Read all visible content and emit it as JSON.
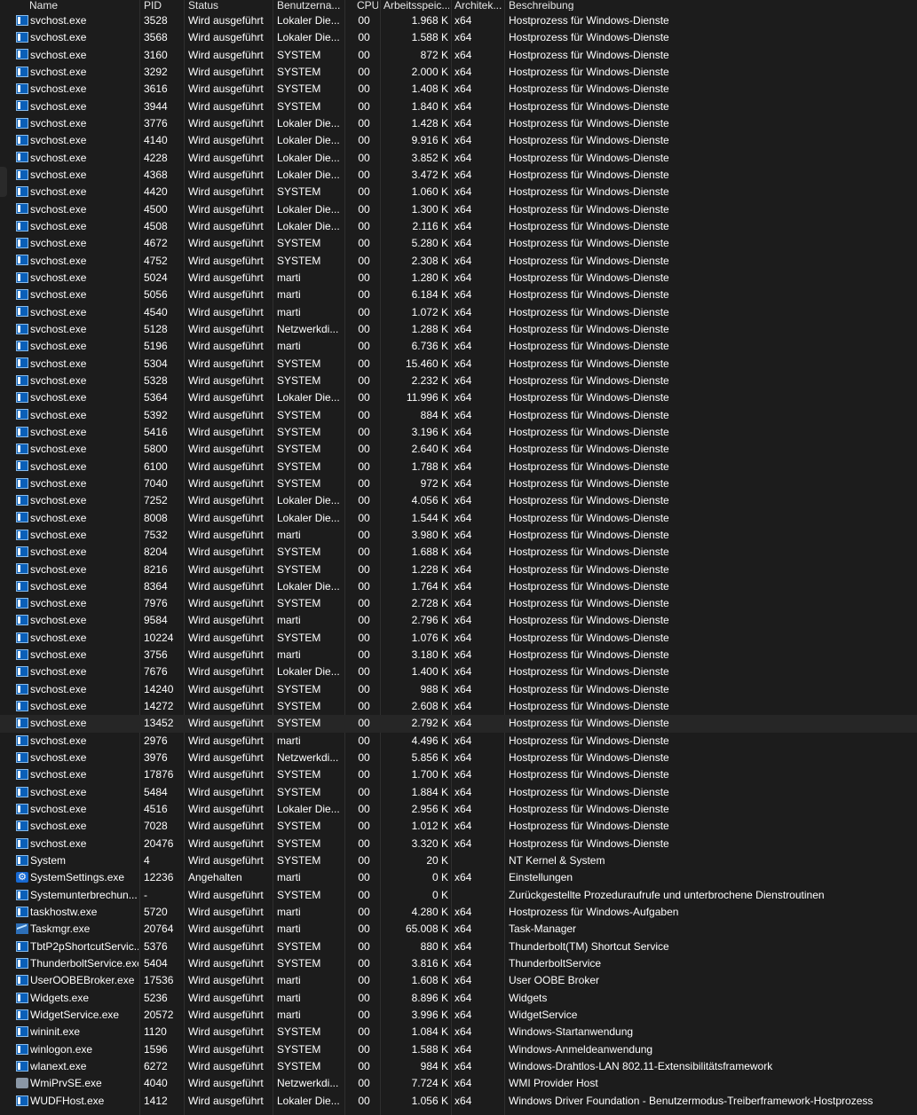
{
  "header": {
    "name": "Name",
    "pid": "PID",
    "status": "Status",
    "user": "Benutzerna...",
    "cpu": "CPU",
    "mem": "Arbeitsspeic...",
    "arch": "Architek...",
    "desc": "Beschreibung"
  },
  "rows": [
    {
      "icon": "window-icon",
      "name": "svchost.exe",
      "pid": "3528",
      "status": "Wird ausgeführt",
      "user": "Lokaler Die...",
      "cpu": "00",
      "mem": "1.968 K",
      "arch": "x64",
      "desc": "Hostprozess für Windows-Dienste"
    },
    {
      "icon": "window-icon",
      "name": "svchost.exe",
      "pid": "3568",
      "status": "Wird ausgeführt",
      "user": "Lokaler Die...",
      "cpu": "00",
      "mem": "1.588 K",
      "arch": "x64",
      "desc": "Hostprozess für Windows-Dienste"
    },
    {
      "icon": "window-icon",
      "name": "svchost.exe",
      "pid": "3160",
      "status": "Wird ausgeführt",
      "user": "SYSTEM",
      "cpu": "00",
      "mem": "872 K",
      "arch": "x64",
      "desc": "Hostprozess für Windows-Dienste"
    },
    {
      "icon": "window-icon",
      "name": "svchost.exe",
      "pid": "3292",
      "status": "Wird ausgeführt",
      "user": "SYSTEM",
      "cpu": "00",
      "mem": "2.000 K",
      "arch": "x64",
      "desc": "Hostprozess für Windows-Dienste"
    },
    {
      "icon": "window-icon",
      "name": "svchost.exe",
      "pid": "3616",
      "status": "Wird ausgeführt",
      "user": "SYSTEM",
      "cpu": "00",
      "mem": "1.408 K",
      "arch": "x64",
      "desc": "Hostprozess für Windows-Dienste"
    },
    {
      "icon": "window-icon",
      "name": "svchost.exe",
      "pid": "3944",
      "status": "Wird ausgeführt",
      "user": "SYSTEM",
      "cpu": "00",
      "mem": "1.840 K",
      "arch": "x64",
      "desc": "Hostprozess für Windows-Dienste"
    },
    {
      "icon": "window-icon",
      "name": "svchost.exe",
      "pid": "3776",
      "status": "Wird ausgeführt",
      "user": "Lokaler Die...",
      "cpu": "00",
      "mem": "1.428 K",
      "arch": "x64",
      "desc": "Hostprozess für Windows-Dienste"
    },
    {
      "icon": "window-icon",
      "name": "svchost.exe",
      "pid": "4140",
      "status": "Wird ausgeführt",
      "user": "Lokaler Die...",
      "cpu": "00",
      "mem": "9.916 K",
      "arch": "x64",
      "desc": "Hostprozess für Windows-Dienste"
    },
    {
      "icon": "window-icon",
      "name": "svchost.exe",
      "pid": "4228",
      "status": "Wird ausgeführt",
      "user": "Lokaler Die...",
      "cpu": "00",
      "mem": "3.852 K",
      "arch": "x64",
      "desc": "Hostprozess für Windows-Dienste"
    },
    {
      "icon": "window-icon",
      "name": "svchost.exe",
      "pid": "4368",
      "status": "Wird ausgeführt",
      "user": "Lokaler Die...",
      "cpu": "00",
      "mem": "3.472 K",
      "arch": "x64",
      "desc": "Hostprozess für Windows-Dienste"
    },
    {
      "icon": "window-icon",
      "name": "svchost.exe",
      "pid": "4420",
      "status": "Wird ausgeführt",
      "user": "SYSTEM",
      "cpu": "00",
      "mem": "1.060 K",
      "arch": "x64",
      "desc": "Hostprozess für Windows-Dienste"
    },
    {
      "icon": "window-icon",
      "name": "svchost.exe",
      "pid": "4500",
      "status": "Wird ausgeführt",
      "user": "Lokaler Die...",
      "cpu": "00",
      "mem": "1.300 K",
      "arch": "x64",
      "desc": "Hostprozess für Windows-Dienste"
    },
    {
      "icon": "window-icon",
      "name": "svchost.exe",
      "pid": "4508",
      "status": "Wird ausgeführt",
      "user": "Lokaler Die...",
      "cpu": "00",
      "mem": "2.116 K",
      "arch": "x64",
      "desc": "Hostprozess für Windows-Dienste"
    },
    {
      "icon": "window-icon",
      "name": "svchost.exe",
      "pid": "4672",
      "status": "Wird ausgeführt",
      "user": "SYSTEM",
      "cpu": "00",
      "mem": "5.280 K",
      "arch": "x64",
      "desc": "Hostprozess für Windows-Dienste"
    },
    {
      "icon": "window-icon",
      "name": "svchost.exe",
      "pid": "4752",
      "status": "Wird ausgeführt",
      "user": "SYSTEM",
      "cpu": "00",
      "mem": "2.308 K",
      "arch": "x64",
      "desc": "Hostprozess für Windows-Dienste"
    },
    {
      "icon": "window-icon",
      "name": "svchost.exe",
      "pid": "5024",
      "status": "Wird ausgeführt",
      "user": "marti",
      "cpu": "00",
      "mem": "1.280 K",
      "arch": "x64",
      "desc": "Hostprozess für Windows-Dienste"
    },
    {
      "icon": "window-icon",
      "name": "svchost.exe",
      "pid": "5056",
      "status": "Wird ausgeführt",
      "user": "marti",
      "cpu": "00",
      "mem": "6.184 K",
      "arch": "x64",
      "desc": "Hostprozess für Windows-Dienste"
    },
    {
      "icon": "window-icon",
      "name": "svchost.exe",
      "pid": "4540",
      "status": "Wird ausgeführt",
      "user": "marti",
      "cpu": "00",
      "mem": "1.072 K",
      "arch": "x64",
      "desc": "Hostprozess für Windows-Dienste"
    },
    {
      "icon": "window-icon",
      "name": "svchost.exe",
      "pid": "5128",
      "status": "Wird ausgeführt",
      "user": "Netzwerkdi...",
      "cpu": "00",
      "mem": "1.288 K",
      "arch": "x64",
      "desc": "Hostprozess für Windows-Dienste"
    },
    {
      "icon": "window-icon",
      "name": "svchost.exe",
      "pid": "5196",
      "status": "Wird ausgeführt",
      "user": "marti",
      "cpu": "00",
      "mem": "6.736 K",
      "arch": "x64",
      "desc": "Hostprozess für Windows-Dienste"
    },
    {
      "icon": "window-icon",
      "name": "svchost.exe",
      "pid": "5304",
      "status": "Wird ausgeführt",
      "user": "SYSTEM",
      "cpu": "00",
      "mem": "15.460 K",
      "arch": "x64",
      "desc": "Hostprozess für Windows-Dienste"
    },
    {
      "icon": "window-icon",
      "name": "svchost.exe",
      "pid": "5328",
      "status": "Wird ausgeführt",
      "user": "SYSTEM",
      "cpu": "00",
      "mem": "2.232 K",
      "arch": "x64",
      "desc": "Hostprozess für Windows-Dienste"
    },
    {
      "icon": "window-icon",
      "name": "svchost.exe",
      "pid": "5364",
      "status": "Wird ausgeführt",
      "user": "Lokaler Die...",
      "cpu": "00",
      "mem": "11.996 K",
      "arch": "x64",
      "desc": "Hostprozess für Windows-Dienste"
    },
    {
      "icon": "window-icon",
      "name": "svchost.exe",
      "pid": "5392",
      "status": "Wird ausgeführt",
      "user": "SYSTEM",
      "cpu": "00",
      "mem": "884 K",
      "arch": "x64",
      "desc": "Hostprozess für Windows-Dienste"
    },
    {
      "icon": "window-icon",
      "name": "svchost.exe",
      "pid": "5416",
      "status": "Wird ausgeführt",
      "user": "SYSTEM",
      "cpu": "00",
      "mem": "3.196 K",
      "arch": "x64",
      "desc": "Hostprozess für Windows-Dienste"
    },
    {
      "icon": "window-icon",
      "name": "svchost.exe",
      "pid": "5800",
      "status": "Wird ausgeführt",
      "user": "SYSTEM",
      "cpu": "00",
      "mem": "2.640 K",
      "arch": "x64",
      "desc": "Hostprozess für Windows-Dienste"
    },
    {
      "icon": "window-icon",
      "name": "svchost.exe",
      "pid": "6100",
      "status": "Wird ausgeführt",
      "user": "SYSTEM",
      "cpu": "00",
      "mem": "1.788 K",
      "arch": "x64",
      "desc": "Hostprozess für Windows-Dienste"
    },
    {
      "icon": "window-icon",
      "name": "svchost.exe",
      "pid": "7040",
      "status": "Wird ausgeführt",
      "user": "SYSTEM",
      "cpu": "00",
      "mem": "972 K",
      "arch": "x64",
      "desc": "Hostprozess für Windows-Dienste"
    },
    {
      "icon": "window-icon",
      "name": "svchost.exe",
      "pid": "7252",
      "status": "Wird ausgeführt",
      "user": "Lokaler Die...",
      "cpu": "00",
      "mem": "4.056 K",
      "arch": "x64",
      "desc": "Hostprozess für Windows-Dienste"
    },
    {
      "icon": "window-icon",
      "name": "svchost.exe",
      "pid": "8008",
      "status": "Wird ausgeführt",
      "user": "Lokaler Die...",
      "cpu": "00",
      "mem": "1.544 K",
      "arch": "x64",
      "desc": "Hostprozess für Windows-Dienste"
    },
    {
      "icon": "window-icon",
      "name": "svchost.exe",
      "pid": "7532",
      "status": "Wird ausgeführt",
      "user": "marti",
      "cpu": "00",
      "mem": "3.980 K",
      "arch": "x64",
      "desc": "Hostprozess für Windows-Dienste"
    },
    {
      "icon": "window-icon",
      "name": "svchost.exe",
      "pid": "8204",
      "status": "Wird ausgeführt",
      "user": "SYSTEM",
      "cpu": "00",
      "mem": "1.688 K",
      "arch": "x64",
      "desc": "Hostprozess für Windows-Dienste"
    },
    {
      "icon": "window-icon",
      "name": "svchost.exe",
      "pid": "8216",
      "status": "Wird ausgeführt",
      "user": "SYSTEM",
      "cpu": "00",
      "mem": "1.228 K",
      "arch": "x64",
      "desc": "Hostprozess für Windows-Dienste"
    },
    {
      "icon": "window-icon",
      "name": "svchost.exe",
      "pid": "8364",
      "status": "Wird ausgeführt",
      "user": "Lokaler Die...",
      "cpu": "00",
      "mem": "1.764 K",
      "arch": "x64",
      "desc": "Hostprozess für Windows-Dienste"
    },
    {
      "icon": "window-icon",
      "name": "svchost.exe",
      "pid": "7976",
      "status": "Wird ausgeführt",
      "user": "SYSTEM",
      "cpu": "00",
      "mem": "2.728 K",
      "arch": "x64",
      "desc": "Hostprozess für Windows-Dienste"
    },
    {
      "icon": "window-icon",
      "name": "svchost.exe",
      "pid": "9584",
      "status": "Wird ausgeführt",
      "user": "marti",
      "cpu": "00",
      "mem": "2.796 K",
      "arch": "x64",
      "desc": "Hostprozess für Windows-Dienste"
    },
    {
      "icon": "window-icon",
      "name": "svchost.exe",
      "pid": "10224",
      "status": "Wird ausgeführt",
      "user": "SYSTEM",
      "cpu": "00",
      "mem": "1.076 K",
      "arch": "x64",
      "desc": "Hostprozess für Windows-Dienste"
    },
    {
      "icon": "window-icon",
      "name": "svchost.exe",
      "pid": "3756",
      "status": "Wird ausgeführt",
      "user": "marti",
      "cpu": "00",
      "mem": "3.180 K",
      "arch": "x64",
      "desc": "Hostprozess für Windows-Dienste"
    },
    {
      "icon": "window-icon",
      "name": "svchost.exe",
      "pid": "7676",
      "status": "Wird ausgeführt",
      "user": "Lokaler Die...",
      "cpu": "00",
      "mem": "1.400 K",
      "arch": "x64",
      "desc": "Hostprozess für Windows-Dienste"
    },
    {
      "icon": "window-icon",
      "name": "svchost.exe",
      "pid": "14240",
      "status": "Wird ausgeführt",
      "user": "SYSTEM",
      "cpu": "00",
      "mem": "988 K",
      "arch": "x64",
      "desc": "Hostprozess für Windows-Dienste"
    },
    {
      "icon": "window-icon",
      "name": "svchost.exe",
      "pid": "14272",
      "status": "Wird ausgeführt",
      "user": "SYSTEM",
      "cpu": "00",
      "mem": "2.608 K",
      "arch": "x64",
      "desc": "Hostprozess für Windows-Dienste"
    },
    {
      "icon": "window-icon",
      "name": "svchost.exe",
      "pid": "13452",
      "status": "Wird ausgeführt",
      "user": "SYSTEM",
      "cpu": "00",
      "mem": "2.792 K",
      "arch": "x64",
      "desc": "Hostprozess für Windows-Dienste",
      "selected": true
    },
    {
      "icon": "window-icon",
      "name": "svchost.exe",
      "pid": "2976",
      "status": "Wird ausgeführt",
      "user": "marti",
      "cpu": "00",
      "mem": "4.496 K",
      "arch": "x64",
      "desc": "Hostprozess für Windows-Dienste"
    },
    {
      "icon": "window-icon",
      "name": "svchost.exe",
      "pid": "3976",
      "status": "Wird ausgeführt",
      "user": "Netzwerkdi...",
      "cpu": "00",
      "mem": "5.856 K",
      "arch": "x64",
      "desc": "Hostprozess für Windows-Dienste"
    },
    {
      "icon": "window-icon",
      "name": "svchost.exe",
      "pid": "17876",
      "status": "Wird ausgeführt",
      "user": "SYSTEM",
      "cpu": "00",
      "mem": "1.700 K",
      "arch": "x64",
      "desc": "Hostprozess für Windows-Dienste"
    },
    {
      "icon": "window-icon",
      "name": "svchost.exe",
      "pid": "5484",
      "status": "Wird ausgeführt",
      "user": "SYSTEM",
      "cpu": "00",
      "mem": "1.884 K",
      "arch": "x64",
      "desc": "Hostprozess für Windows-Dienste"
    },
    {
      "icon": "window-icon",
      "name": "svchost.exe",
      "pid": "4516",
      "status": "Wird ausgeführt",
      "user": "Lokaler Die...",
      "cpu": "00",
      "mem": "2.956 K",
      "arch": "x64",
      "desc": "Hostprozess für Windows-Dienste"
    },
    {
      "icon": "window-icon",
      "name": "svchost.exe",
      "pid": "7028",
      "status": "Wird ausgeführt",
      "user": "SYSTEM",
      "cpu": "00",
      "mem": "1.012 K",
      "arch": "x64",
      "desc": "Hostprozess für Windows-Dienste"
    },
    {
      "icon": "window-icon",
      "name": "svchost.exe",
      "pid": "20476",
      "status": "Wird ausgeführt",
      "user": "SYSTEM",
      "cpu": "00",
      "mem": "3.320 K",
      "arch": "x64",
      "desc": "Hostprozess für Windows-Dienste"
    },
    {
      "icon": "window-icon",
      "name": "System",
      "pid": "4",
      "status": "Wird ausgeführt",
      "user": "SYSTEM",
      "cpu": "00",
      "mem": "20 K",
      "arch": "",
      "desc": "NT Kernel & System"
    },
    {
      "icon": "gear-icon",
      "name": "SystemSettings.exe",
      "pid": "12236",
      "status": "Angehalten",
      "user": "marti",
      "cpu": "00",
      "mem": "0 K",
      "arch": "x64",
      "desc": "Einstellungen"
    },
    {
      "icon": "window-icon",
      "name": "Systemunterbrechun...",
      "pid": "-",
      "status": "Wird ausgeführt",
      "user": "SYSTEM",
      "cpu": "00",
      "mem": "0 K",
      "arch": "",
      "desc": "Zurückgestellte Prozeduraufrufe und unterbrochene Dienstroutinen"
    },
    {
      "icon": "window-icon",
      "name": "taskhostw.exe",
      "pid": "5720",
      "status": "Wird ausgeführt",
      "user": "marti",
      "cpu": "00",
      "mem": "4.280 K",
      "arch": "x64",
      "desc": "Hostprozess für Windows-Aufgaben"
    },
    {
      "icon": "chart-icon",
      "name": "Taskmgr.exe",
      "pid": "20764",
      "status": "Wird ausgeführt",
      "user": "marti",
      "cpu": "00",
      "mem": "65.008 K",
      "arch": "x64",
      "desc": "Task-Manager"
    },
    {
      "icon": "window-icon",
      "name": "TbtP2pShortcutServic...",
      "pid": "5376",
      "status": "Wird ausgeführt",
      "user": "SYSTEM",
      "cpu": "00",
      "mem": "880 K",
      "arch": "x64",
      "desc": "Thunderbolt(TM) Shortcut Service"
    },
    {
      "icon": "window-icon",
      "name": "ThunderboltService.exe",
      "pid": "5404",
      "status": "Wird ausgeführt",
      "user": "SYSTEM",
      "cpu": "00",
      "mem": "3.816 K",
      "arch": "x64",
      "desc": "ThunderboltService"
    },
    {
      "icon": "window-icon",
      "name": "UserOOBEBroker.exe",
      "pid": "17536",
      "status": "Wird ausgeführt",
      "user": "marti",
      "cpu": "00",
      "mem": "1.608 K",
      "arch": "x64",
      "desc": "User OOBE Broker"
    },
    {
      "icon": "window-icon",
      "name": "Widgets.exe",
      "pid": "5236",
      "status": "Wird ausgeführt",
      "user": "marti",
      "cpu": "00",
      "mem": "8.896 K",
      "arch": "x64",
      "desc": "Widgets"
    },
    {
      "icon": "window-icon",
      "name": "WidgetService.exe",
      "pid": "20572",
      "status": "Wird ausgeführt",
      "user": "marti",
      "cpu": "00",
      "mem": "3.996 K",
      "arch": "x64",
      "desc": "WidgetService"
    },
    {
      "icon": "window-icon",
      "name": "wininit.exe",
      "pid": "1120",
      "status": "Wird ausgeführt",
      "user": "SYSTEM",
      "cpu": "00",
      "mem": "1.084 K",
      "arch": "x64",
      "desc": "Windows-Startanwendung"
    },
    {
      "icon": "window-icon",
      "name": "winlogon.exe",
      "pid": "1596",
      "status": "Wird ausgeführt",
      "user": "SYSTEM",
      "cpu": "00",
      "mem": "1.588 K",
      "arch": "x64",
      "desc": "Windows-Anmeldeanwendung"
    },
    {
      "icon": "window-icon",
      "name": "wlanext.exe",
      "pid": "6272",
      "status": "Wird ausgeführt",
      "user": "SYSTEM",
      "cpu": "00",
      "mem": "984 K",
      "arch": "x64",
      "desc": "Windows-Drahtlos-LAN 802.11-Extensibilitätsframework"
    },
    {
      "icon": "wmi-icon",
      "name": "WmiPrvSE.exe",
      "pid": "4040",
      "status": "Wird ausgeführt",
      "user": "Netzwerkdi...",
      "cpu": "00",
      "mem": "7.724 K",
      "arch": "x64",
      "desc": "WMI Provider Host"
    },
    {
      "icon": "window-icon",
      "name": "WUDFHost.exe",
      "pid": "1412",
      "status": "Wird ausgeführt",
      "user": "Lokaler Die...",
      "cpu": "00",
      "mem": "1.056 K",
      "arch": "x64",
      "desc": "Windows Driver Foundation - Benutzermodus-Treiberframework-Hostprozess"
    }
  ]
}
